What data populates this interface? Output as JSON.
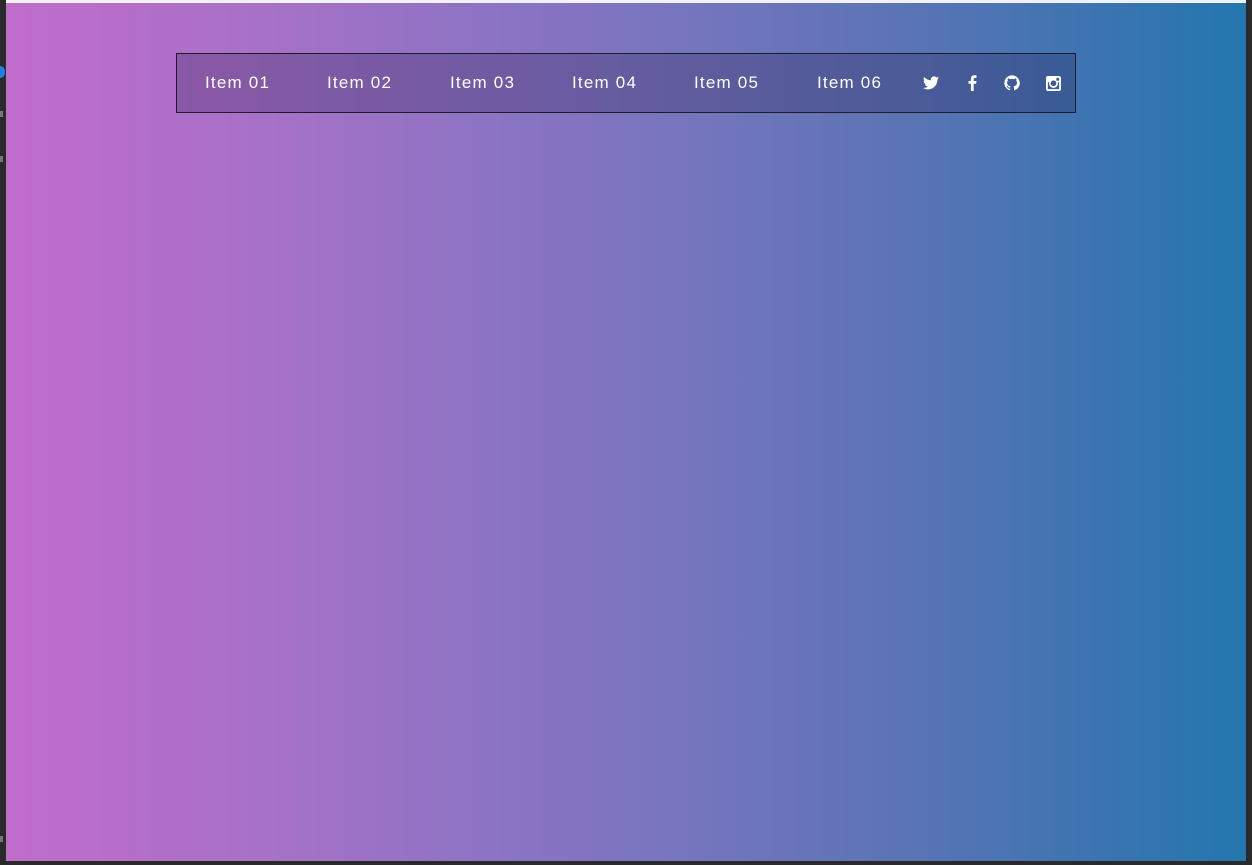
{
  "nav": {
    "items": [
      {
        "label": "Item 01"
      },
      {
        "label": "Item 02"
      },
      {
        "label": "Item 03"
      },
      {
        "label": "Item 04"
      },
      {
        "label": "Item 05"
      },
      {
        "label": "Item 06"
      }
    ],
    "social": [
      {
        "icon": "twitter-icon"
      },
      {
        "icon": "facebook-icon"
      },
      {
        "icon": "github-icon"
      },
      {
        "icon": "instagram-icon"
      }
    ]
  },
  "colors": {
    "gradient_start": "#c16ccd",
    "gradient_end": "#2376af",
    "nav_text": "#ffffff",
    "nav_border": "#1c1c2a"
  }
}
